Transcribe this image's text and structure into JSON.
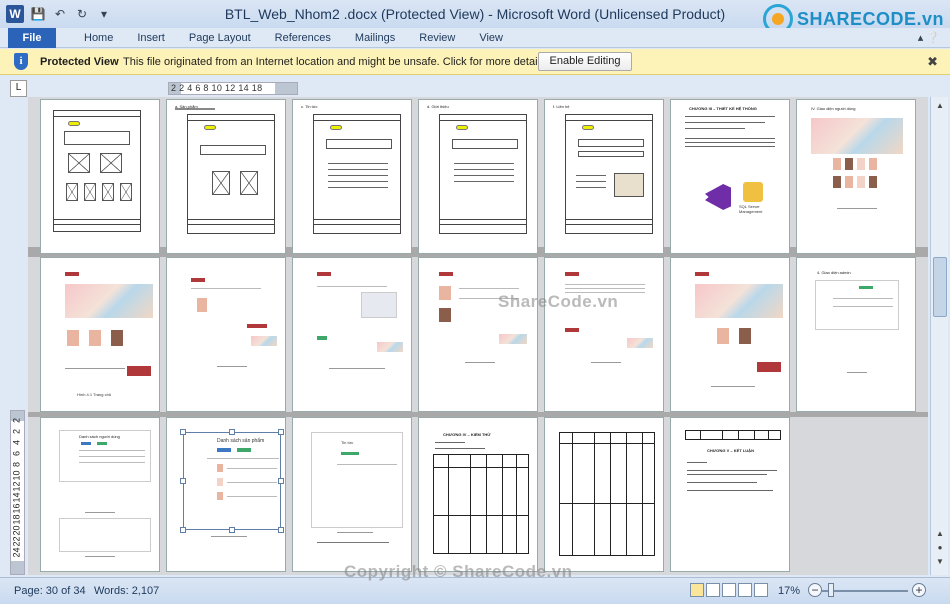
{
  "window": {
    "title": "BTL_Web_Nhom2 .docx (Protected View)  -  Microsoft Word (Unlicensed Product)",
    "app_icon": "W"
  },
  "brand": {
    "name": "SHARECODE.vn"
  },
  "ribbon": {
    "file_label": "File",
    "tabs": [
      "Home",
      "Insert",
      "Page Layout",
      "References",
      "Mailings",
      "Review",
      "View"
    ]
  },
  "protected_view": {
    "title": "Protected View",
    "message": "This file originated from an Internet location and might be unsafe. Click for more details.",
    "button_label": "Enable Editing",
    "close_icon": "close-icon"
  },
  "ruler": {
    "corner": "L",
    "ticks": "2   2 4 6 8 10 12 14   18",
    "vertical_ticks": [
      "2",
      "2",
      "4",
      "6",
      "8",
      "10",
      "12",
      "14",
      "16",
      "18",
      "20",
      "22",
      "24"
    ]
  },
  "page_texts": {
    "p2_title": "a. Sản phẩm",
    "p3_title": "c. Tin tức",
    "p4_title": "d. Giới thiệu",
    "p5_title": "f. Liên hệ",
    "p6_title": "CHƯƠNG III – THIẾT KẾ HỆ THỐNG",
    "p7_title": "IV. Giao diện người dùng",
    "sql_label": "SQL Server Management",
    "row2_caption": "Hình 4.1 Trang chủ",
    "p14_title": "4. Giao diện admin",
    "p15_title": "Danh sách người dùng",
    "p16_title": "Danh sách sản phẩm",
    "p17_title": "Tin tức",
    "p18_title": "CHƯƠNG IV – KIỂM THỬ",
    "p20_title": "CHƯƠNG V – KẾT LUẬN"
  },
  "status": {
    "page": "Page: 30 of 34",
    "words": "Words: 2,107",
    "zoom": "17%"
  },
  "watermarks": [
    "ShareCode.vn",
    "Copyright © ShareCode.vn"
  ],
  "colors": {
    "file_tab": "#2a63b8",
    "protected_bar": "#fdf3b8",
    "doc_background": "#a9a9a9"
  }
}
